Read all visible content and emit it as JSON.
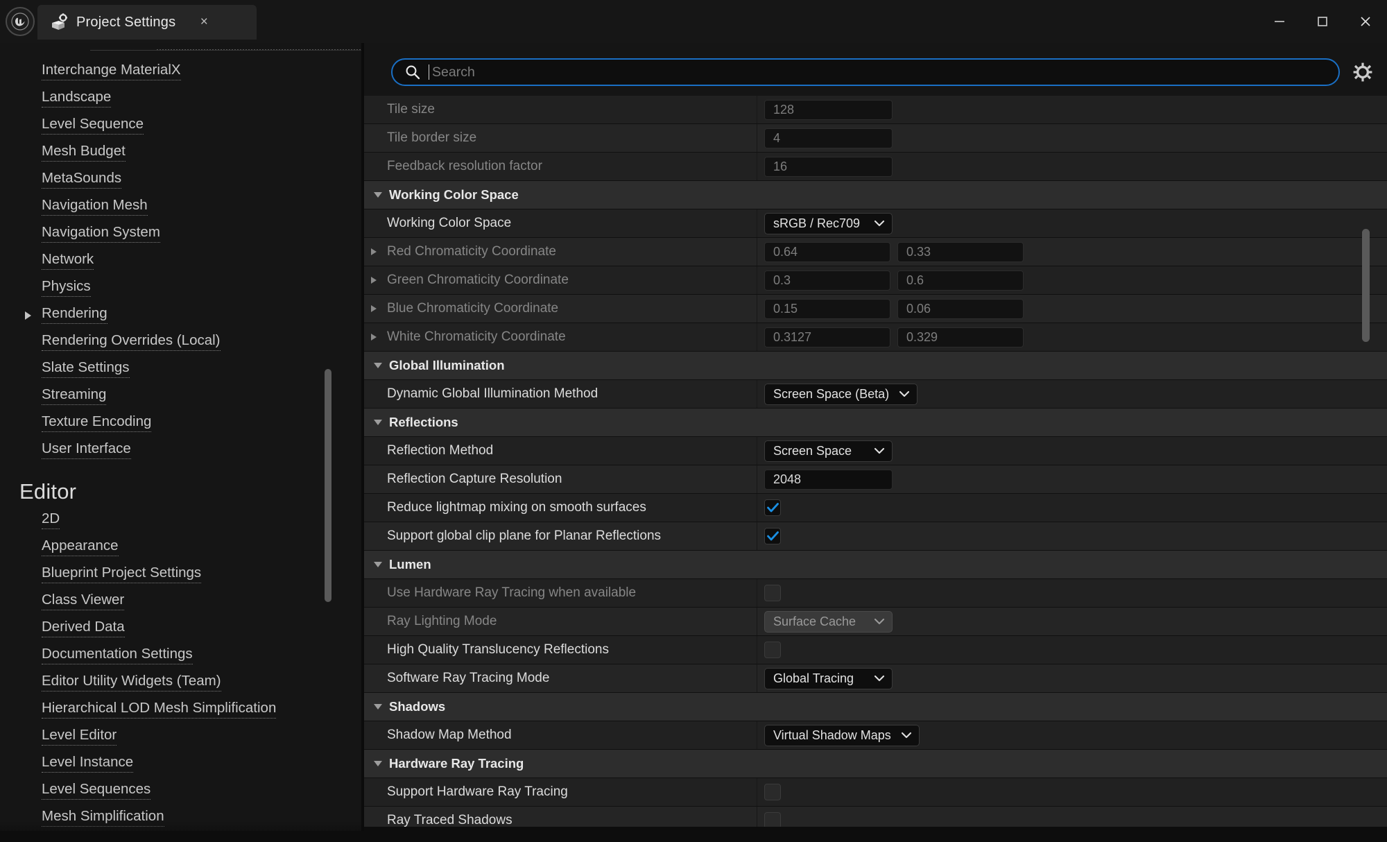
{
  "window": {
    "app_logo": "unreal-engine-logo",
    "tab_title": "Project Settings",
    "tab_icon": "project-settings-box-gear-icon",
    "close_tab_glyph": "×",
    "minimize_glyph": "—",
    "maximize_glyph": "□",
    "close_glyph": "✕",
    "accent_blue": "#1a6fc4",
    "check_blue": "#1a8fe3"
  },
  "sidebar": {
    "items": [
      {
        "label": "Interchange MaterialX",
        "expandable": false
      },
      {
        "label": "Landscape",
        "expandable": false
      },
      {
        "label": "Level Sequence",
        "expandable": false
      },
      {
        "label": "Mesh Budget",
        "expandable": false
      },
      {
        "label": "MetaSounds",
        "expandable": false
      },
      {
        "label": "Navigation Mesh",
        "expandable": false
      },
      {
        "label": "Navigation System",
        "expandable": false
      },
      {
        "label": "Network",
        "expandable": false
      },
      {
        "label": "Physics",
        "expandable": false
      },
      {
        "label": "Rendering",
        "expandable": true
      },
      {
        "label": "Rendering Overrides (Local)",
        "expandable": false
      },
      {
        "label": "Slate Settings",
        "expandable": false
      },
      {
        "label": "Streaming",
        "expandable": false
      },
      {
        "label": "Texture Encoding",
        "expandable": false
      },
      {
        "label": "User Interface",
        "expandable": false
      }
    ],
    "group_heading": "Editor",
    "editor_items": [
      {
        "label": "2D",
        "expandable": false
      },
      {
        "label": "Appearance",
        "expandable": false
      },
      {
        "label": "Blueprint Project Settings",
        "expandable": false
      },
      {
        "label": "Class Viewer",
        "expandable": false
      },
      {
        "label": "Derived Data",
        "expandable": false
      },
      {
        "label": "Documentation Settings",
        "expandable": false
      },
      {
        "label": "Editor Utility Widgets (Team)",
        "expandable": false
      },
      {
        "label": "Hierarchical LOD Mesh Simplification",
        "expandable": false
      },
      {
        "label": "Level Editor",
        "expandable": false
      },
      {
        "label": "Level Instance",
        "expandable": false
      },
      {
        "label": "Level Sequences",
        "expandable": false
      },
      {
        "label": "Mesh Simplification",
        "expandable": false
      }
    ]
  },
  "search": {
    "value": "",
    "placeholder": "Search",
    "icon": "search-icon",
    "settings_icon": "gear-icon"
  },
  "settings": {
    "rows": [
      {
        "kind": "field",
        "name": "Tile size",
        "dim": true,
        "value": "128"
      },
      {
        "kind": "field",
        "name": "Tile border size",
        "dim": true,
        "value": "4"
      },
      {
        "kind": "field",
        "name": "Feedback resolution factor",
        "dim": true,
        "value": "16"
      },
      {
        "kind": "section",
        "name": "Working Color Space"
      },
      {
        "kind": "combo",
        "name": "Working Color Space",
        "dim": false,
        "value": "sRGB / Rec709"
      },
      {
        "kind": "field2",
        "name": "Red Chromaticity Coordinate",
        "dim": true,
        "caret": true,
        "value": "0.64",
        "value2": "0.33"
      },
      {
        "kind": "field2",
        "name": "Green Chromaticity Coordinate",
        "dim": true,
        "caret": true,
        "value": "0.3",
        "value2": "0.6"
      },
      {
        "kind": "field2",
        "name": "Blue Chromaticity Coordinate",
        "dim": true,
        "caret": true,
        "value": "0.15",
        "value2": "0.06"
      },
      {
        "kind": "field2",
        "name": "White Chromaticity Coordinate",
        "dim": true,
        "caret": true,
        "value": "0.3127",
        "value2": "0.329"
      },
      {
        "kind": "section",
        "name": "Global Illumination"
      },
      {
        "kind": "combo",
        "name": "Dynamic Global Illumination Method",
        "dim": false,
        "value": "Screen Space (Beta)"
      },
      {
        "kind": "section",
        "name": "Reflections"
      },
      {
        "kind": "combo",
        "name": "Reflection Method",
        "dim": false,
        "value": "Screen Space"
      },
      {
        "kind": "field",
        "name": "Reflection Capture Resolution",
        "dim": false,
        "value": "2048"
      },
      {
        "kind": "check",
        "name": "Reduce lightmap mixing on smooth surfaces",
        "dim": false,
        "checked": true
      },
      {
        "kind": "check",
        "name": "Support global clip plane for Planar Reflections",
        "dim": false,
        "checked": true
      },
      {
        "kind": "section",
        "name": "Lumen"
      },
      {
        "kind": "check",
        "name": "Use Hardware Ray Tracing when available",
        "dim": true,
        "checked": false
      },
      {
        "kind": "combo",
        "name": "Ray Lighting Mode",
        "dim": true,
        "value": "Surface Cache"
      },
      {
        "kind": "check",
        "name": "High Quality Translucency Reflections",
        "dim": false,
        "checked": false
      },
      {
        "kind": "combo",
        "name": "Software Ray Tracing Mode",
        "dim": false,
        "value": "Global Tracing"
      },
      {
        "kind": "section",
        "name": "Shadows"
      },
      {
        "kind": "combo",
        "name": "Shadow Map Method",
        "dim": false,
        "value": "Virtual Shadow Maps"
      },
      {
        "kind": "section",
        "name": "Hardware Ray Tracing"
      },
      {
        "kind": "check",
        "name": "Support Hardware Ray Tracing",
        "dim": false,
        "checked": false
      },
      {
        "kind": "check",
        "name": "Ray Traced Shadows",
        "dim": false,
        "checked": false
      }
    ]
  }
}
